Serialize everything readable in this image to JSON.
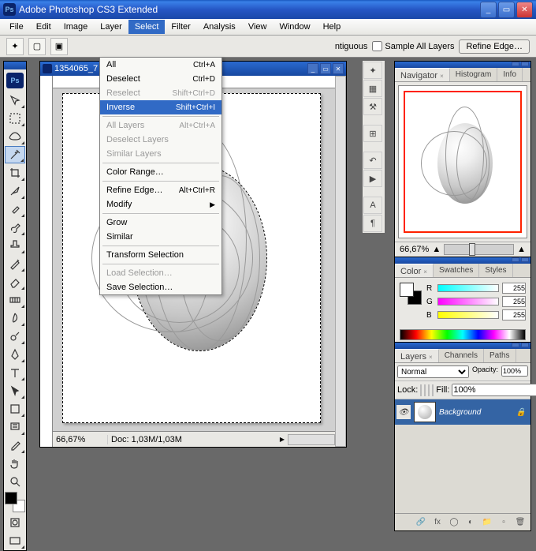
{
  "title": "Adobe Photoshop CS3 Extended",
  "app_icon": "Ps",
  "menubar": [
    "File",
    "Edit",
    "Image",
    "Layer",
    "Select",
    "Filter",
    "Analysis",
    "View",
    "Window",
    "Help"
  ],
  "open_menu_index": 4,
  "dropdown": {
    "items": [
      {
        "label": "All",
        "shortcut": "Ctrl+A",
        "enabled": true
      },
      {
        "label": "Deselect",
        "shortcut": "Ctrl+D",
        "enabled": true
      },
      {
        "label": "Reselect",
        "shortcut": "Shift+Ctrl+D",
        "enabled": false
      },
      {
        "label": "Inverse",
        "shortcut": "Shift+Ctrl+I",
        "enabled": true,
        "highlight": true
      },
      {
        "sep": true
      },
      {
        "label": "All Layers",
        "shortcut": "Alt+Ctrl+A",
        "enabled": false
      },
      {
        "label": "Deselect Layers",
        "enabled": false
      },
      {
        "label": "Similar Layers",
        "enabled": false
      },
      {
        "sep": true
      },
      {
        "label": "Color Range…",
        "enabled": true
      },
      {
        "sep": true
      },
      {
        "label": "Refine Edge…",
        "shortcut": "Alt+Ctrl+R",
        "enabled": true
      },
      {
        "label": "Modify",
        "enabled": true,
        "submenu": true
      },
      {
        "sep": true
      },
      {
        "label": "Grow",
        "enabled": true
      },
      {
        "label": "Similar",
        "enabled": true
      },
      {
        "sep": true
      },
      {
        "label": "Transform Selection",
        "enabled": true
      },
      {
        "sep": true
      },
      {
        "label": "Load Selection…",
        "enabled": false
      },
      {
        "label": "Save Selection…",
        "enabled": true
      }
    ]
  },
  "options": {
    "contiguous": "ntiguous",
    "sample_all": "Sample All Layers",
    "refine_btn": "Refine Edge…"
  },
  "doc": {
    "title": "1354065_7",
    "zoom": "66,67%",
    "info": "Doc: 1,03M/1,03M"
  },
  "navigator": {
    "tabs": [
      "Navigator",
      "Histogram",
      "Info"
    ],
    "zoom": "66,67%"
  },
  "color": {
    "tabs": [
      "Color",
      "Swatches",
      "Styles"
    ],
    "r": "255",
    "g": "255",
    "b": "255"
  },
  "layers": {
    "tabs": [
      "Layers",
      "Channels",
      "Paths"
    ],
    "blend": "Normal",
    "opacity_label": "Opacity:",
    "opacity": "100%",
    "lock_label": "Lock:",
    "fill_label": "Fill:",
    "fill": "100%",
    "layer_name": "Background"
  },
  "tool_icon": "Ps"
}
